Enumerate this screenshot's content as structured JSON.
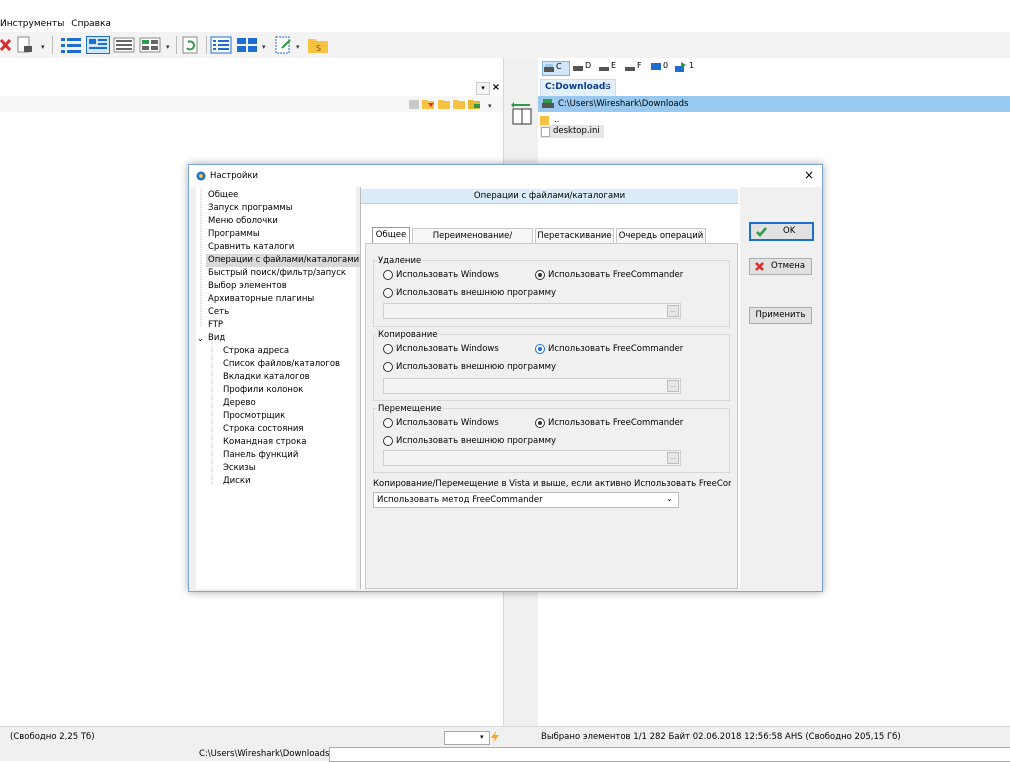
{
  "menubar": {
    "items": [
      "Инструменты",
      "Справка"
    ]
  },
  "left_pane": {
    "status": "(Свободно 2,25 Тб)"
  },
  "right_pane": {
    "drives": [
      "C",
      "D",
      "E",
      "F",
      "0",
      "1"
    ],
    "tab": "C:Downloads",
    "path": "C:\\Users\\Wireshark\\Downloads",
    "files": [
      "..",
      "desktop.ini"
    ],
    "status": "Выбрано элементов 1/1  282 Байт  02.06.2018 12:56:58  AHS  (Свободно 205,15 Гб)"
  },
  "cmdline": {
    "path": "C:\\Users\\Wireshark\\Downloads\\"
  },
  "dialog": {
    "title": "Настройки",
    "close": "×",
    "tree": {
      "top": [
        "Общее",
        "Запуск программы",
        "Меню оболочки",
        "Программы",
        "Сравнить каталоги",
        "Операции с файлами/каталогами",
        "Быстрый поиск/фильтр/запуск",
        "Выбор элементов",
        "Архиваторные плагины",
        "Сеть",
        "FTP"
      ],
      "view_label": "Вид",
      "view_children": [
        "Строка адреса",
        "Список файлов/каталогов",
        "Вкладки каталогов",
        "Профили колонок",
        "Дерево",
        "Просмотрщик",
        "Строка состояния",
        "Командная строка",
        "Панель функций",
        "Эскизы",
        "Диски"
      ]
    },
    "header": "Операции с файлами/каталогами",
    "tabs": [
      "Общее",
      "Переименование/Создание",
      "Перетаскивание",
      "Очередь операций"
    ],
    "groups": [
      {
        "label": "Удаление",
        "opt_windows": "Использовать Windows",
        "opt_fc": "Использовать FreeCommander",
        "opt_ext": "Использовать внешнюю программу"
      },
      {
        "label": "Копирование",
        "opt_windows": "Использовать Windows",
        "opt_fc": "Использовать FreeCommander",
        "opt_ext": "Использовать внешнюю программу"
      },
      {
        "label": "Перемещение",
        "opt_windows": "Использовать Windows",
        "opt_fc": "Использовать FreeCommander",
        "opt_ext": "Использовать внешнюю программу"
      }
    ],
    "vista_label": "Копирование/Перемещение в Vista и выше, если активно Использовать FreeCommar",
    "vista_select": "Использовать метод FreeCommander",
    "buttons": {
      "ok": "OK",
      "cancel": "Отмена",
      "apply": "Применить"
    },
    "field_btn": "..."
  },
  "colors": {
    "accent": "#1c6fd0",
    "selection": "#99c9ef",
    "folder": "#f5c242"
  }
}
